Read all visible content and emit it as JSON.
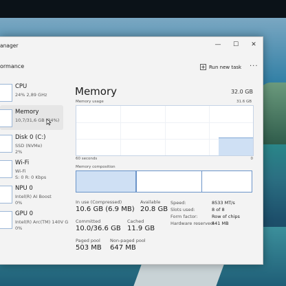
{
  "window": {
    "title": "anager",
    "controls": {
      "minimize": "—",
      "maximize": "☐",
      "close": "✕"
    }
  },
  "header": {
    "section": "ormance",
    "run_new_task": "Run new task",
    "more": "···"
  },
  "sidebar": {
    "items": [
      {
        "name": "CPU",
        "line1": "24%  2,89 GHz",
        "line2": ""
      },
      {
        "name": "Memory",
        "line1": "10,7/31,6 GB (34%)",
        "line2": ""
      },
      {
        "name": "Disk 0 (C:)",
        "line1": "SSD (NVMe)",
        "line2": "2%"
      },
      {
        "name": "Wi-Fi",
        "line1": "Wi-Fi",
        "line2": "S: 0 R: 0 Kbps"
      },
      {
        "name": "NPU 0",
        "line1": "Intel(R) AI Boost",
        "line2": "0%"
      },
      {
        "name": "GPU 0",
        "line1": "Intel(R) Arc(TM) 140V G",
        "line2": "0%"
      }
    ],
    "active_index": 1
  },
  "memory": {
    "title": "Memory",
    "total": "32.0 GB",
    "usage_label": "Memory usage",
    "usage_max": "31.6 GB",
    "axis_left": "60 seconds",
    "axis_right": "0",
    "composition_label": "Memory composition",
    "stats": {
      "in_use_label": "In use (Compressed)",
      "in_use_value": "10.6 GB (6.9 MB)",
      "available_label": "Available",
      "available_value": "20.8 GB",
      "committed_label": "Committed",
      "committed_value": "10.0/36.6 GB",
      "cached_label": "Cached",
      "cached_value": "11.9 GB",
      "paged_label": "Paged pool",
      "paged_value": "503 MB",
      "nonpaged_label": "Non-paged pool",
      "nonpaged_value": "647 MB"
    },
    "details": [
      {
        "key": "Speed:",
        "value": "8533 MT/s"
      },
      {
        "key": "Slots used:",
        "value": "8 of 8"
      },
      {
        "key": "Form factor:",
        "value": "Row of chips"
      },
      {
        "key": "Hardware reserved:",
        "value": "441 MB"
      }
    ]
  },
  "colors": {
    "accent": "#6a93c8",
    "accent_fill": "#cfe0f4"
  }
}
